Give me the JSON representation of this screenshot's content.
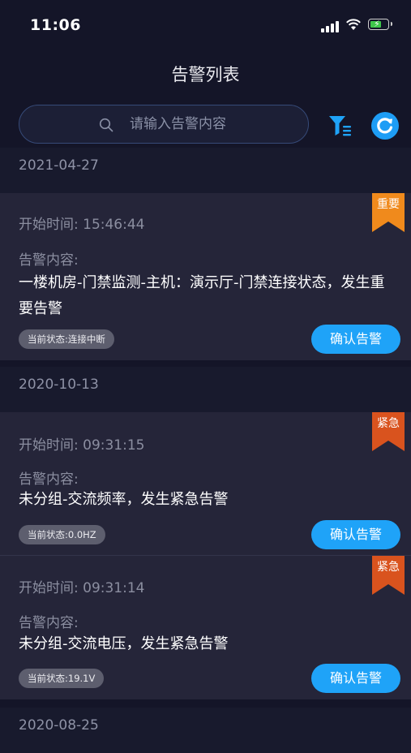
{
  "status_bar": {
    "time": "11:06"
  },
  "header": {
    "title": "告警列表"
  },
  "search": {
    "placeholder": "请输入告警内容"
  },
  "colors": {
    "accent": "#1fa3f8",
    "important_ribbon": "#f08a1c",
    "urgent_ribbon": "#d9531e",
    "background": "#141528",
    "card": "#252539"
  },
  "icons": {
    "filter": "filter-list-icon",
    "refresh": "refresh-icon",
    "search": "search-icon"
  },
  "groups": [
    {
      "date": "2021-04-27",
      "alarms": [
        {
          "level": "重要",
          "start": "开始时间: 15:46:44",
          "content_label": "告警内容:",
          "content": "一楼机房-门禁监测-主机：演示厅-门禁连接状态，发生重要告警",
          "state": "当前状态:连接中断",
          "confirm": "确认告警"
        }
      ]
    },
    {
      "date": "2020-10-13",
      "alarms": [
        {
          "level": "紧急",
          "start": "开始时间: 09:31:15",
          "content_label": "告警内容:",
          "content": "未分组-交流频率，发生紧急告警",
          "state": "当前状态:0.0HZ",
          "confirm": "确认告警"
        },
        {
          "level": "紧急",
          "start": "开始时间: 09:31:14",
          "content_label": "告警内容:",
          "content": "未分组-交流电压，发生紧急告警",
          "state": "当前状态:19.1V",
          "confirm": "确认告警"
        }
      ]
    },
    {
      "date": "2020-08-25",
      "alarms": []
    }
  ]
}
